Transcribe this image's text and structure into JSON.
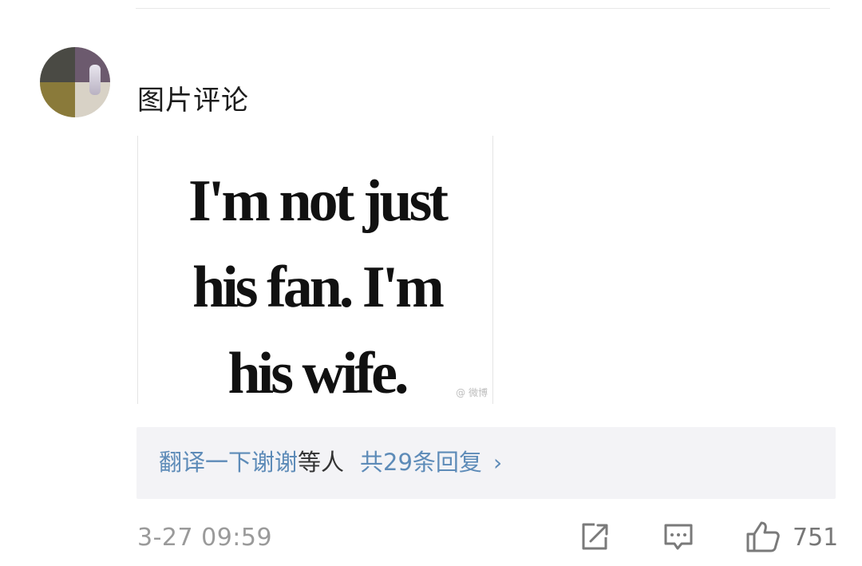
{
  "comment": {
    "text": "图片评论",
    "image": {
      "caption_lines": [
        "I'm not just",
        "his fan. I'm",
        "his wife."
      ],
      "watermark": "@ 微博"
    }
  },
  "replies": {
    "names": "翻译一下谢谢",
    "deng": "等人",
    "count_text": "共29条回复",
    "chevron": "›"
  },
  "footer": {
    "timestamp": "3-27 09:59",
    "like_count": "751",
    "icons": [
      "share-icon",
      "comment-icon",
      "like-icon"
    ]
  },
  "colors": {
    "link": "#5d8bb8",
    "reply_bg": "#f3f3f6",
    "meta": "#9a9a9a"
  }
}
